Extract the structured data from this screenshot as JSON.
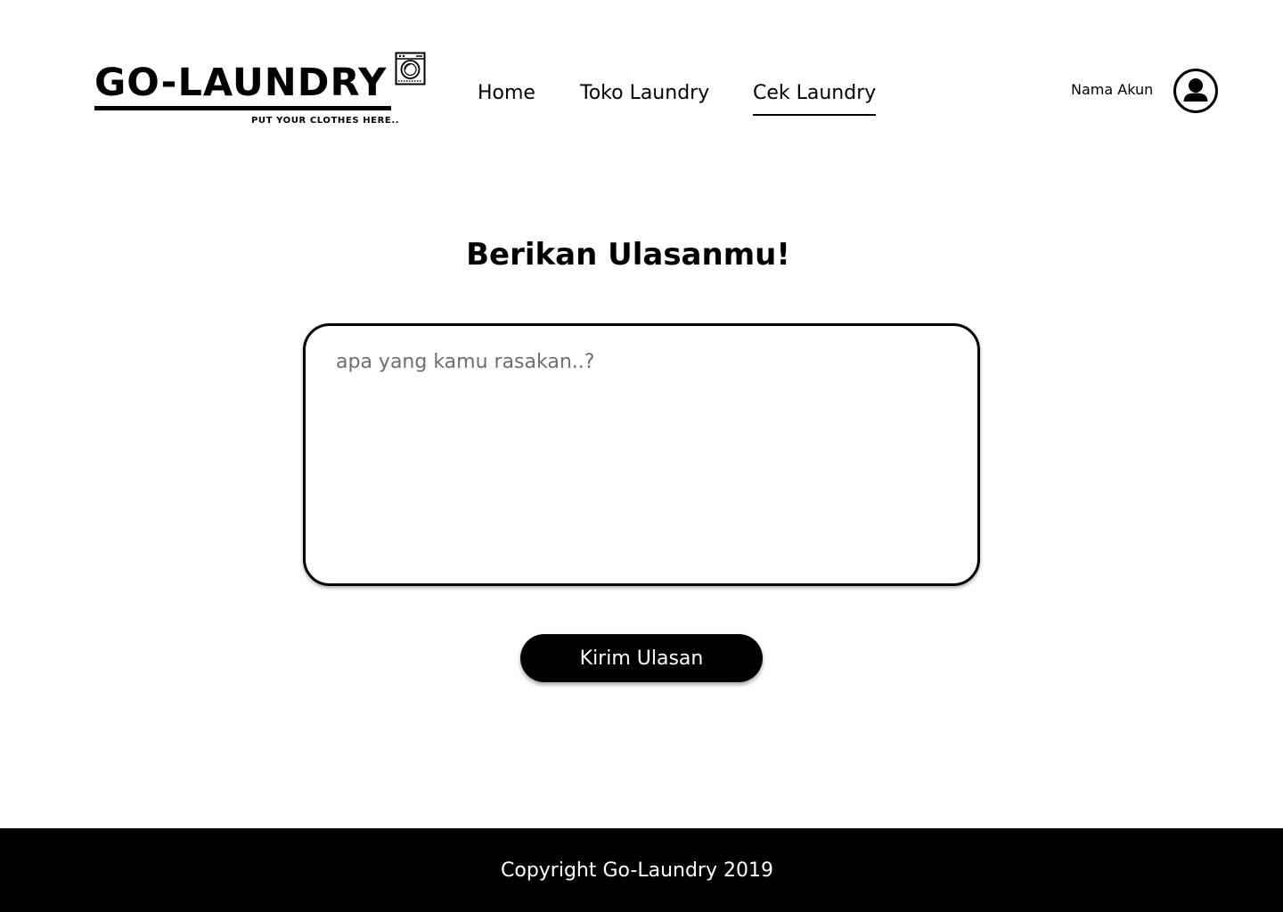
{
  "header": {
    "logo": {
      "wordmark": "GO-LAUNDRY",
      "tagline": "PUT YOUR CLOTHES HERE.."
    },
    "nav": [
      {
        "label": "Home",
        "active": false
      },
      {
        "label": "Toko Laundry",
        "active": false
      },
      {
        "label": "Cek Laundry",
        "active": true
      }
    ],
    "account": {
      "name": "Nama Akun",
      "icon": "user-circle-icon"
    }
  },
  "main": {
    "title": "Berikan Ulasanmu!",
    "review": {
      "value": "",
      "placeholder": "apa yang kamu rasakan..?"
    },
    "submit_label": "Kirim Ulasan"
  },
  "footer": {
    "copyright": "Copyright Go-Laundry 2019"
  },
  "colors": {
    "primary": "#000000",
    "background": "#ffffff",
    "placeholder": "#6e6e6e"
  }
}
